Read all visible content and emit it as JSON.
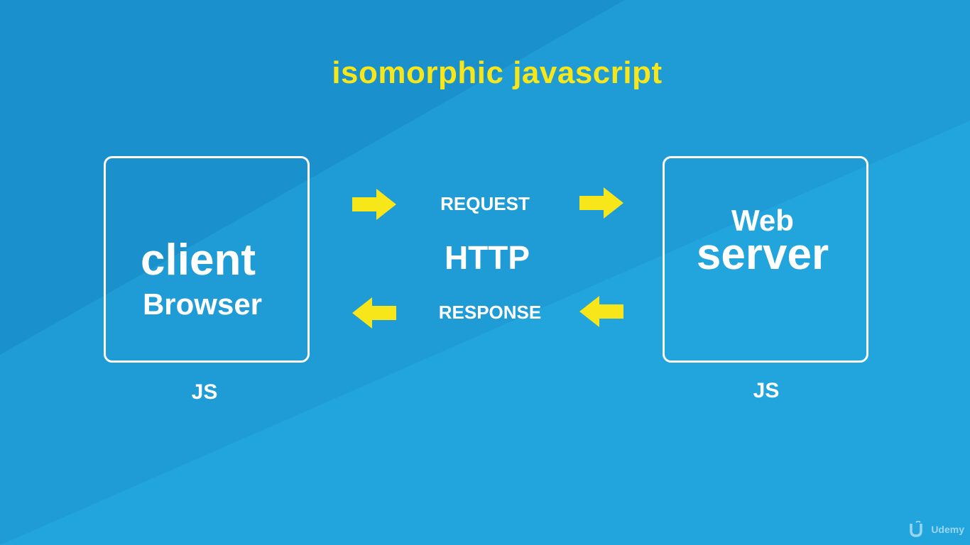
{
  "title": "isomorphic javascript",
  "client": {
    "line1": "client",
    "line2": "Browser",
    "tech": "JS"
  },
  "server": {
    "line1": "Web",
    "line2": "server",
    "tech": "JS"
  },
  "protocol": {
    "request": "REQUEST",
    "name": "HTTP",
    "response": "RESPONSE"
  },
  "brand": {
    "name": "Udemy",
    "icon": "udemy-logo-icon"
  },
  "colors": {
    "background": "#21a3dc",
    "background_dark": "#1a8fcc",
    "accent": "#f6e61a",
    "text": "#ffffff"
  }
}
